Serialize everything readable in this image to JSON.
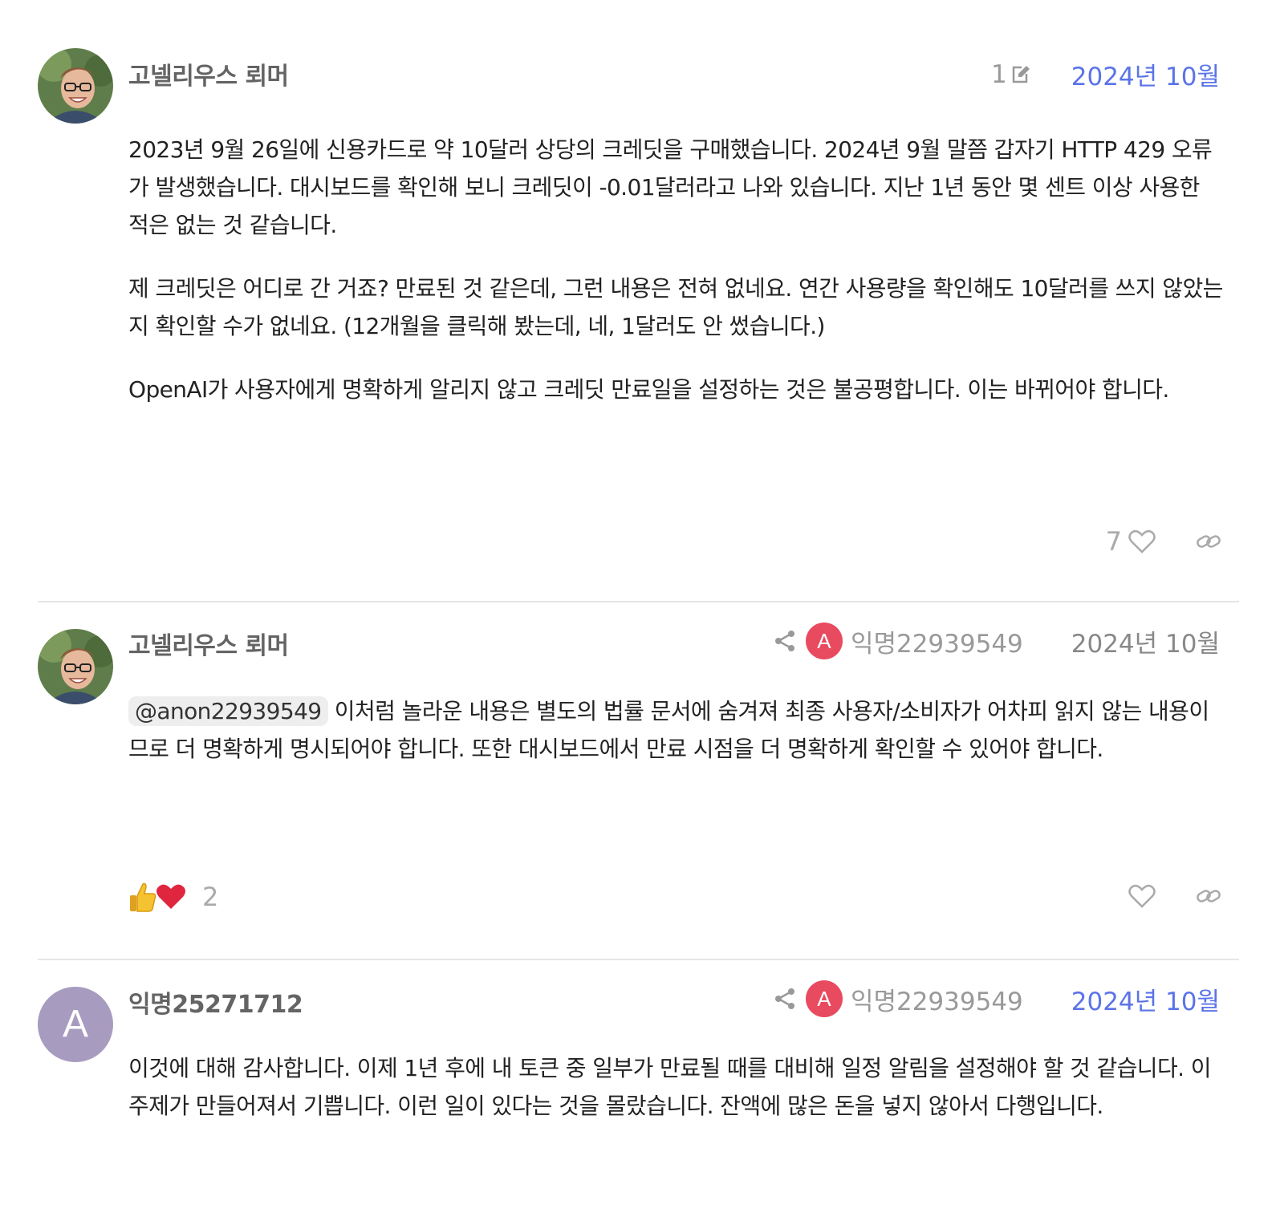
{
  "posts": [
    {
      "username": "고넬리우스 뢰머",
      "edit_count": "1",
      "date": "2024년 10월",
      "paragraphs": [
        "2023년 9월 26일에 신용카드로 약 10달러 상당의 크레딧을 구매했습니다. 2024년 9월 말쯤 갑자기 HTTP 429 오류가 발생했습니다. 대시보드를 확인해 보니 크레딧이 -0.01달러라고 나와 있습니다. 지난 1년 동안 몇 센트 이상 사용한 적은 없는 것 같습니다.",
        "제 크레딧은 어디로 간 거죠? 만료된 것 같은데, 그런 내용은 전혀 없네요. 연간 사용량을 확인해도 10달러를 쓰지 않았는지 확인할 수가 없네요. (12개월을 클릭해 봤는데, 네, 1달러도 안 썼습니다.)",
        "OpenAI가 사용자에게 명확하게 알리지 않고 크레딧 만료일을 설정하는 것은 불공평합니다. 이는 바뀌어야 합니다."
      ],
      "like_count": "7"
    },
    {
      "username": "고넬리우스 뢰머",
      "reply_to_avatar_letter": "A",
      "reply_to": "익명22939549",
      "date": "2024년 10월",
      "mention": "@anon22939549",
      "text": " 이처럼 놀라운 내용은 별도의 법률 문서에 숨겨져 최종 사용자/소비자가 어차피 읽지 않는 내용이므로 더 명확하게 명시되어야 합니다. 또한 대시보드에서 만료 시점을 더 명확하게 확인할 수 있어야 합니다.",
      "reaction_count": "2"
    },
    {
      "avatar_letter": "A",
      "username": "익명25271712",
      "reply_to_avatar_letter": "A",
      "reply_to": "익명22939549",
      "date": "2024년 10월",
      "text": "이것에 대해 감사합니다. 이제 1년 후에 내 토큰 중 일부가 만료될 때를 대비해 일정 알림을 설정해야 할 것 같습니다. 이 주제가 만들어져서 기쁩니다. 이런 일이 있다는 것을 몰랐습니다. 잔액에 많은 돈을 넣지 않아서 다행입니다."
    }
  ]
}
